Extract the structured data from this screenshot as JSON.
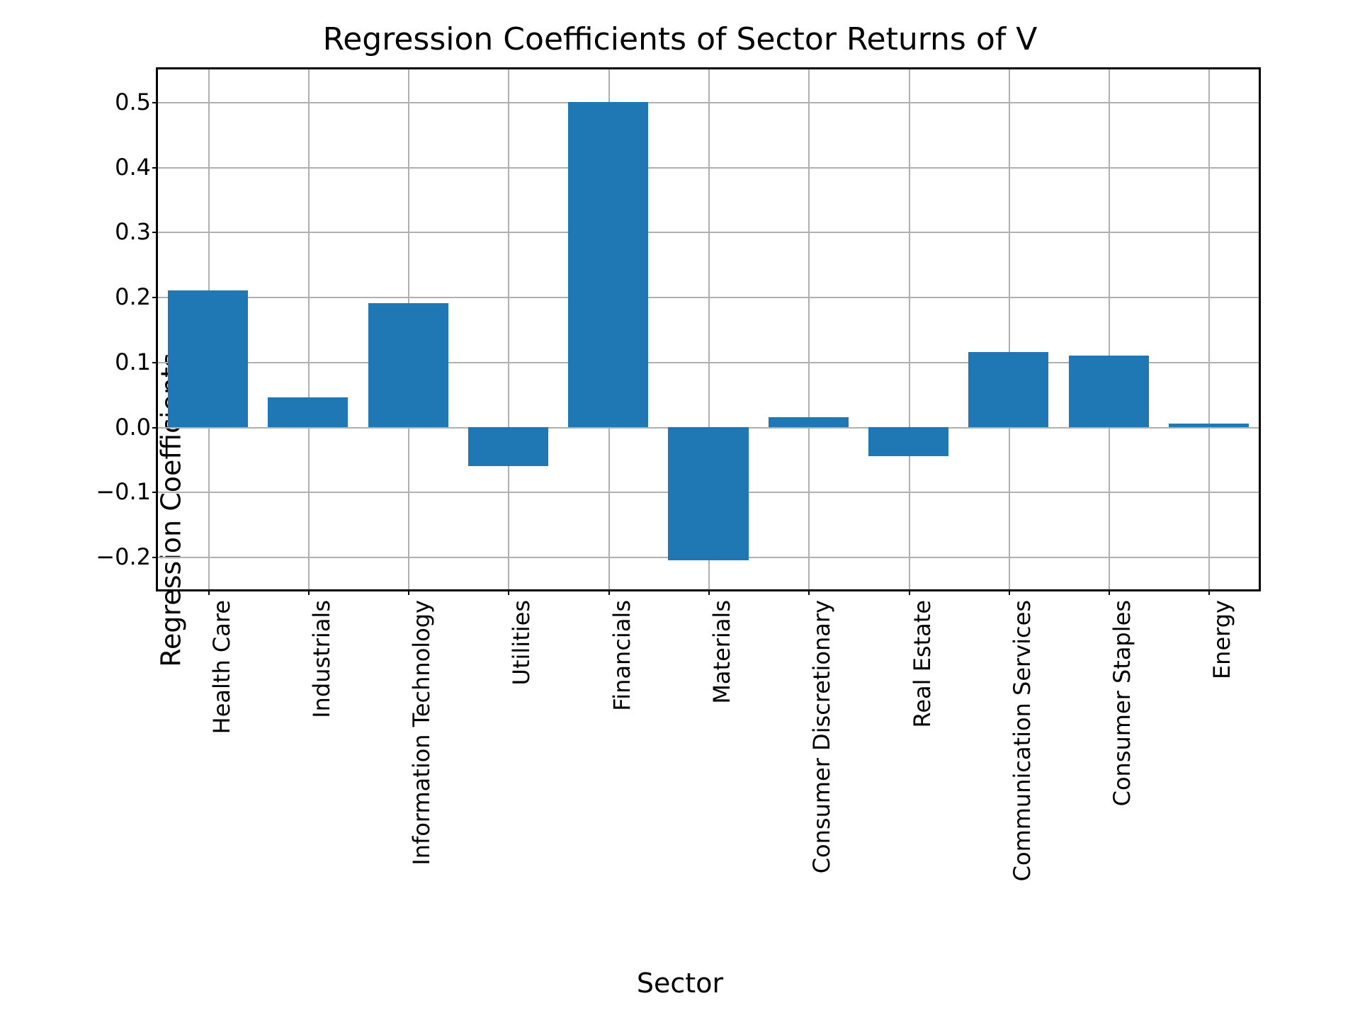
{
  "chart_data": {
    "type": "bar",
    "title": "Regression Coefficients of Sector Returns of V",
    "xlabel": "Sector",
    "ylabel": "Regression Coefficients",
    "ylim": [
      -0.25,
      0.55
    ],
    "yticks": [
      -0.2,
      -0.1,
      0.0,
      0.1,
      0.2,
      0.3,
      0.4,
      0.5
    ],
    "ytick_labels": [
      "−0.2",
      "−0.1",
      "0.0",
      "0.1",
      "0.2",
      "0.3",
      "0.4",
      "0.5"
    ],
    "categories": [
      "Health Care",
      "Industrials",
      "Information Technology",
      "Utilities",
      "Financials",
      "Materials",
      "Consumer Discretionary",
      "Real Estate",
      "Communication Services",
      "Consumer Staples",
      "Energy"
    ],
    "values": [
      0.21,
      0.045,
      0.19,
      -0.06,
      0.5,
      -0.205,
      0.015,
      -0.045,
      0.115,
      0.11,
      0.005
    ],
    "bar_color": "#1f77b4"
  }
}
